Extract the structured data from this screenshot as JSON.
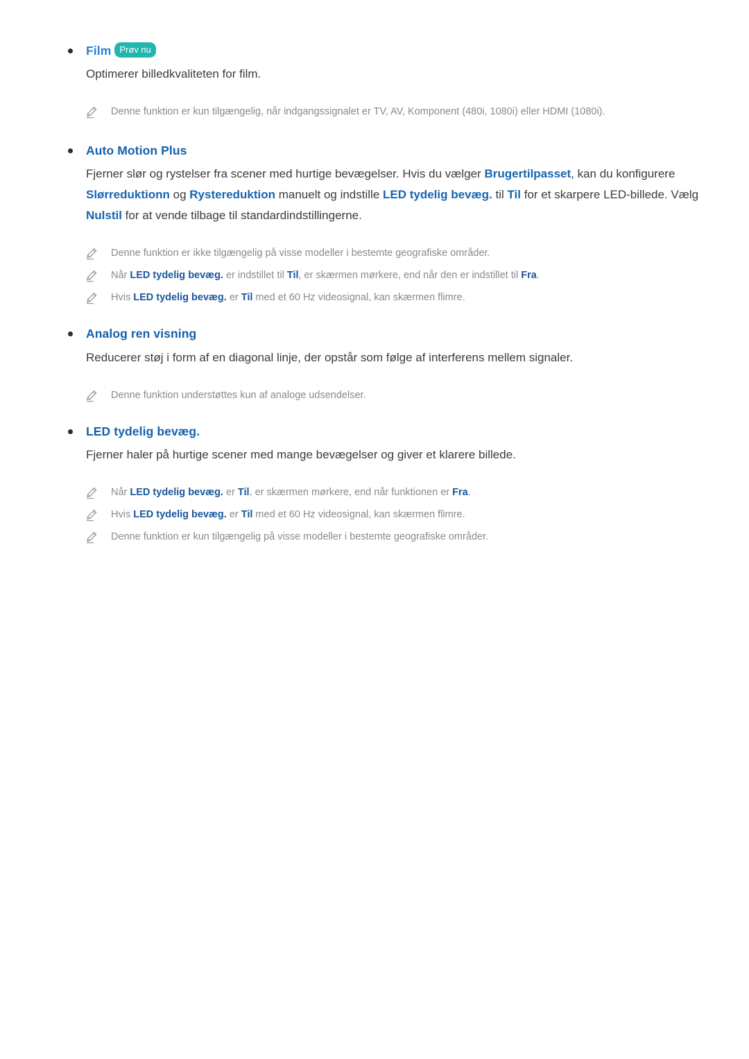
{
  "colors": {
    "heading_blue": "#1460ab",
    "heading_blue_bright": "#2b7fd4",
    "inline_blue": "#1565b0",
    "badge_teal": "#21b6ae",
    "note_gray": "#8a8a8a",
    "body_gray": "#3b3b3b",
    "bullet_black": "#2b2b2b"
  },
  "icons": {
    "note": "pencil-icon",
    "bullet": "bullet-dot"
  },
  "sections": [
    {
      "id": "film",
      "heading": "Film",
      "badge": "Prøv nu",
      "body": {
        "p1_a": "Optimerer billedkvaliteten for film."
      },
      "notes": [
        {
          "a": "Denne funktion er kun tilgængelig, når indgangssignalet er TV, AV, Komponent (480i, 1080i) eller HDMI (1080i)."
        }
      ]
    },
    {
      "id": "auto-motion-plus",
      "heading": "Auto Motion Plus",
      "body": {
        "a": "Fjerner slør og rystelser fra scener med hurtige bevægelser. Hvis du vælger ",
        "b1": "Brugertilpasset",
        "b": ", kan du konfigurere ",
        "b2": "Slørreduktionn",
        "c": " og ",
        "b3": "Rystereduktion",
        "d": " manuelt og indstille ",
        "b4": "LED tydelig bevæg.",
        "e": " til ",
        "b5": "Til",
        "f": " for et skarpere LED-billede. Vælg ",
        "b6": "Nulstil",
        "g": " for at vende tilbage til standardindstillingerne."
      },
      "notes": [
        {
          "a": "Denne funktion er ikke tilgængelig på visse modeller i bestemte geografiske områder."
        },
        {
          "a": "Når ",
          "b1": "LED tydelig bevæg.",
          "b": " er indstillet til ",
          "b2": "Til",
          "c": ", er skærmen mørkere, end når den er indstillet til ",
          "b3": "Fra",
          "d": "."
        },
        {
          "a": "Hvis ",
          "b1": "LED tydelig bevæg.",
          "b": " er ",
          "b2": "Til",
          "c": " med et 60 Hz videosignal, kan skærmen flimre."
        }
      ]
    },
    {
      "id": "analog-ren-visning",
      "heading": "Analog ren visning",
      "body": {
        "a": "Reducerer støj i form af en diagonal linje, der opstår som følge af interferens mellem signaler."
      },
      "notes": [
        {
          "a": "Denne funktion understøttes kun af analoge udsendelser."
        }
      ]
    },
    {
      "id": "led-tydelig-bevaeg",
      "heading": "LED tydelig bevæg.",
      "body": {
        "a": "Fjerner haler på hurtige scener med mange bevægelser og giver et klarere billede."
      },
      "notes": [
        {
          "a": "Når ",
          "b1": "LED tydelig bevæg.",
          "b": " er ",
          "b2": "Til",
          "c": ", er skærmen mørkere, end når funktionen er ",
          "b3": "Fra",
          "d": "."
        },
        {
          "a": "Hvis ",
          "b1": "LED tydelig bevæg.",
          "b": " er ",
          "b2": "Til",
          "c": " med et 60 Hz videosignal, kan skærmen flimre."
        },
        {
          "a": "Denne funktion er kun tilgængelig på visse modeller i bestemte geografiske områder."
        }
      ]
    }
  ]
}
